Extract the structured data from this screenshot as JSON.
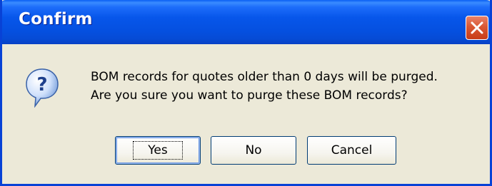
{
  "window": {
    "title": "Confirm"
  },
  "titlebar": {
    "close_icon": "close-icon"
  },
  "dialog": {
    "icon": "question-icon",
    "message_line1": "BOM records for quotes older than 0 days will be purged.",
    "message_line2": "Are you sure you want to purge these BOM records?"
  },
  "buttons": {
    "yes_label": "Yes",
    "no_label": "No",
    "cancel_label": "Cancel",
    "default": "Yes"
  },
  "colors": {
    "titlebar": "#0756ea",
    "close_button": "#d95733",
    "dialog_background": "#ece9d8",
    "button_border": "#003c74"
  }
}
